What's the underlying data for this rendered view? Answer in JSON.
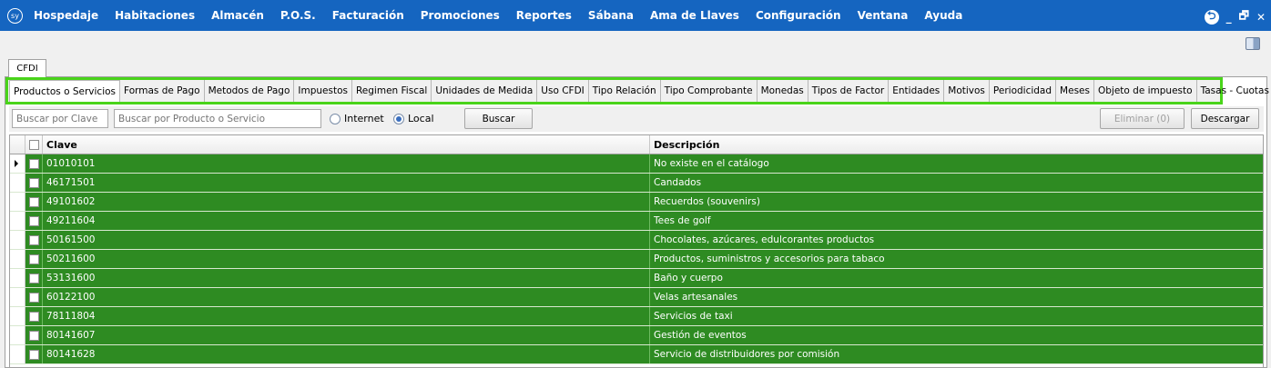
{
  "menu": {
    "logo": "sy",
    "items": [
      "Hospedaje",
      "Habitaciones",
      "Almacén",
      "P.O.S.",
      "Facturación",
      "Promociones",
      "Reportes",
      "Sábana",
      "Ama de Llaves",
      "Configuración",
      "Ventana",
      "Ayuda"
    ],
    "window_controls": {
      "minimize": "_",
      "restore": "🗗",
      "close": "✕"
    }
  },
  "outer_tab": "CFDI",
  "catalog_tabs": [
    "Productos o Servicios",
    "Formas de Pago",
    "Metodos de Pago",
    "Impuestos",
    "Regimen Fiscal",
    "Unidades de Medida",
    "Uso CFDI",
    "Tipo Relación",
    "Tipo Comprobante",
    "Monedas",
    "Tipos de Factor",
    "Entidades",
    "Motivos",
    "Periodicidad",
    "Meses",
    "Objeto de impuesto",
    "Tasas - Cuotas"
  ],
  "active_tab": "Productos o Servicios",
  "toolbar": {
    "clave_placeholder": "Buscar por Clave",
    "producto_placeholder": "Buscar por Producto o Servicio",
    "radio_internet": "Internet",
    "radio_local": "Local",
    "selected_source": "Local",
    "buscar_label": "Buscar",
    "eliminar_label": "Eliminar (0)",
    "descargar_label": "Descargar"
  },
  "grid": {
    "columns": [
      "Clave",
      "Descripción"
    ],
    "rows": [
      {
        "clave": "01010101",
        "descripcion": "No existe en el catálogo"
      },
      {
        "clave": "46171501",
        "descripcion": "Candados"
      },
      {
        "clave": "49101602",
        "descripcion": "Recuerdos (souvenirs)"
      },
      {
        "clave": "49211604",
        "descripcion": "Tees de golf"
      },
      {
        "clave": "50161500",
        "descripcion": "Chocolates, azúcares, edulcorantes productos"
      },
      {
        "clave": "50211600",
        "descripcion": "Productos, suministros y accesorios para tabaco"
      },
      {
        "clave": "53131600",
        "descripcion": "Baño y cuerpo"
      },
      {
        "clave": "60122100",
        "descripcion": "Velas artesanales"
      },
      {
        "clave": "78111804",
        "descripcion": "Servicios de taxi"
      },
      {
        "clave": "80141607",
        "descripcion": "Gestión de eventos"
      },
      {
        "clave": "80141628",
        "descripcion": "Servicio de distribuidores por comisión"
      }
    ]
  },
  "colors": {
    "menu_bar": "#1565c0",
    "row_highlight": "#2e8b22",
    "tab_frame_highlight": "#49d41a"
  }
}
